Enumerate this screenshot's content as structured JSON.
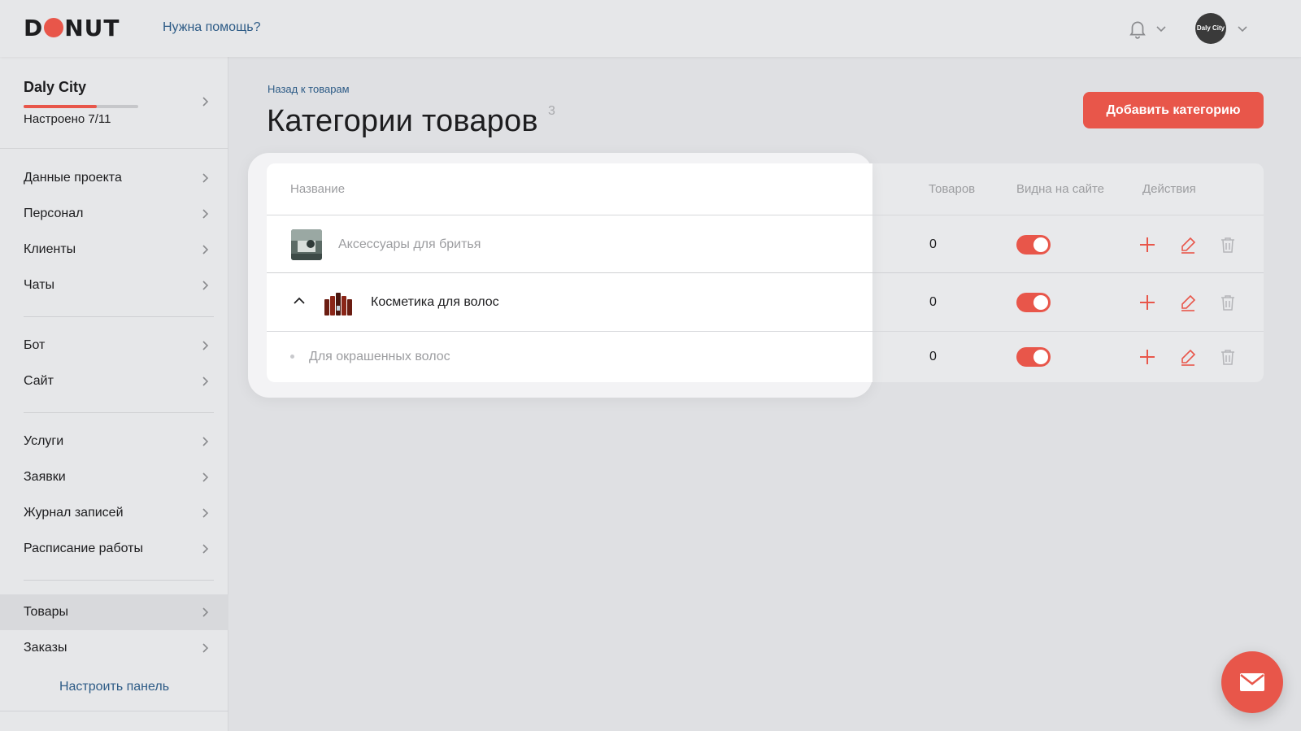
{
  "header": {
    "logo_left": "D",
    "logo_right": "NUT",
    "help_link": "Нужна помощь?",
    "avatar_label": "Daly City"
  },
  "sidebar": {
    "project": {
      "name": "Daly City",
      "status": "Настроено 7/11",
      "progress_fraction": 0.64
    },
    "groups": [
      [
        "Данные проекта",
        "Персонал",
        "Клиенты",
        "Чаты"
      ],
      [
        "Бот",
        "Сайт"
      ],
      [
        "Услуги",
        "Заявки",
        "Журнал записей",
        "Расписание работы"
      ],
      [
        "Товары",
        "Заказы"
      ]
    ],
    "items": {
      "project_data": "Данные проекта",
      "staff": "Персонал",
      "clients": "Клиенты",
      "chats": "Чаты",
      "bot": "Бот",
      "site": "Сайт",
      "services": "Услуги",
      "requests": "Заявки",
      "journal": "Журнал записей",
      "schedule": "Расписание работы",
      "products": "Товары",
      "orders": "Заказы"
    },
    "active": "Товары",
    "customize": "Настроить панель"
  },
  "main": {
    "back_link": "Назад к товарам",
    "title": "Категории товаров",
    "title_count": "3",
    "add_button": "Добавить категорию",
    "table": {
      "columns": {
        "name": "Название",
        "products": "Товаров",
        "visible": "Видна на сайте",
        "actions": "Действия"
      },
      "rows": [
        {
          "name": "Аксессуары для бритья",
          "products": "0",
          "visible": true,
          "muted": true
        },
        {
          "name": "Косметика для волос",
          "products": "0",
          "visible": true,
          "muted": false,
          "expanded": true
        },
        {
          "name": "Для окрашенных волос",
          "products": "0",
          "visible": true,
          "muted": true,
          "child": true
        }
      ]
    }
  },
  "colors": {
    "accent": "#e8564a",
    "link": "#2d5b86",
    "bg": "#dfe0e3"
  },
  "icons": [
    "bell-icon",
    "chevron-down-icon",
    "chevron-right-icon",
    "chevron-up-icon",
    "plus-icon",
    "edit-icon",
    "trash-icon",
    "mail-icon"
  ]
}
